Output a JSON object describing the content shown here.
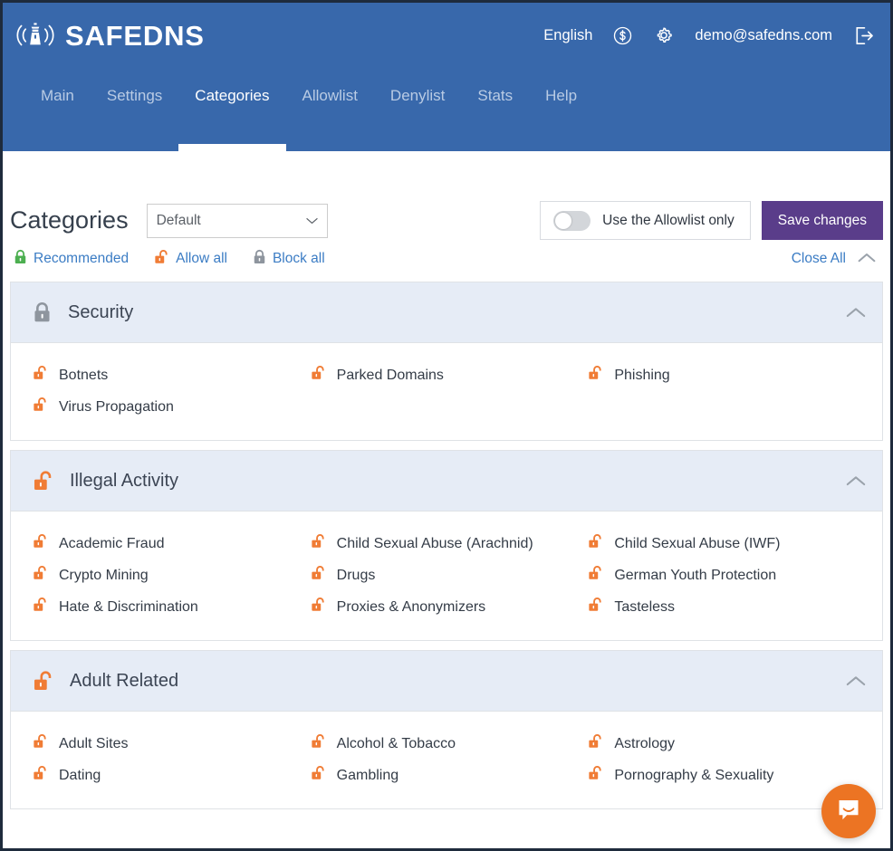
{
  "brand": {
    "name": "SAFEDNS",
    "logo_icon": "lighthouse-signal-icon"
  },
  "header": {
    "language": "English",
    "billing_icon": "dollar-circle-icon",
    "settings_icon": "gear-icon",
    "user_email": "demo@safedns.com",
    "logout_icon": "logout-icon"
  },
  "nav": {
    "items": [
      {
        "label": "Main",
        "active": false
      },
      {
        "label": "Settings",
        "active": false
      },
      {
        "label": "Categories",
        "active": true
      },
      {
        "label": "Allowlist",
        "active": false
      },
      {
        "label": "Denylist",
        "active": false
      },
      {
        "label": "Stats",
        "active": false
      },
      {
        "label": "Help",
        "active": false
      }
    ]
  },
  "page": {
    "title": "Categories",
    "profile_select": {
      "value": "Default",
      "chevron_icon": "chevron-down-icon",
      "options": [
        "Default"
      ]
    },
    "allowlist_toggle": {
      "label": "Use the Allowlist only",
      "state": "off"
    },
    "save_button": "Save changes",
    "quick_actions": [
      {
        "label": "Recommended",
        "icon": "lock-closed-icon",
        "icon_color": "#4caf50"
      },
      {
        "label": "Allow all",
        "icon": "lock-open-icon",
        "icon_color": "#f07c35"
      },
      {
        "label": "Block all",
        "icon": "lock-closed-icon",
        "icon_color": "#8e959e"
      }
    ],
    "close_all": {
      "label": "Close All",
      "chevron_icon": "chevron-up-icon"
    }
  },
  "colors": {
    "header_blue": "#3868ab",
    "card_head": "#e6ecf6",
    "link_blue": "#3b7cc4",
    "save_purple": "#5a3d8a",
    "lock_open_orange": "#f07c35",
    "lock_closed_gray": "#8e959e",
    "lock_closed_green": "#4caf50",
    "chat_orange": "#ec7423"
  },
  "sections": [
    {
      "title": "Security",
      "lock_state": "closed",
      "lock_color": "#8e959e",
      "collapse_icon": "chevron-up-icon",
      "expanded": true,
      "items": [
        {
          "label": "Botnets",
          "lock_state": "open"
        },
        {
          "label": "Parked Domains",
          "lock_state": "open"
        },
        {
          "label": "Phishing",
          "lock_state": "open"
        },
        {
          "label": "Virus Propagation",
          "lock_state": "open"
        }
      ]
    },
    {
      "title": "Illegal Activity",
      "lock_state": "open",
      "lock_color": "#f07c35",
      "collapse_icon": "chevron-up-icon",
      "expanded": true,
      "items": [
        {
          "label": "Academic Fraud",
          "lock_state": "open"
        },
        {
          "label": "Child Sexual Abuse (Arachnid)",
          "lock_state": "open"
        },
        {
          "label": "Child Sexual Abuse (IWF)",
          "lock_state": "open"
        },
        {
          "label": "Crypto Mining",
          "lock_state": "open"
        },
        {
          "label": "Drugs",
          "lock_state": "open"
        },
        {
          "label": "German Youth Protection",
          "lock_state": "open"
        },
        {
          "label": "Hate & Discrimination",
          "lock_state": "open"
        },
        {
          "label": "Proxies & Anonymizers",
          "lock_state": "open"
        },
        {
          "label": "Tasteless",
          "lock_state": "open"
        }
      ]
    },
    {
      "title": "Adult Related",
      "lock_state": "open",
      "lock_color": "#f07c35",
      "collapse_icon": "chevron-up-icon",
      "expanded": true,
      "items": [
        {
          "label": "Adult Sites",
          "lock_state": "open"
        },
        {
          "label": "Alcohol & Tobacco",
          "lock_state": "open"
        },
        {
          "label": "Astrology",
          "lock_state": "open"
        },
        {
          "label": "Dating",
          "lock_state": "open"
        },
        {
          "label": "Gambling",
          "lock_state": "open"
        },
        {
          "label": "Pornography & Sexuality",
          "lock_state": "open"
        }
      ]
    }
  ],
  "chat_widget": {
    "icon": "chat-bubble-smile-icon"
  }
}
